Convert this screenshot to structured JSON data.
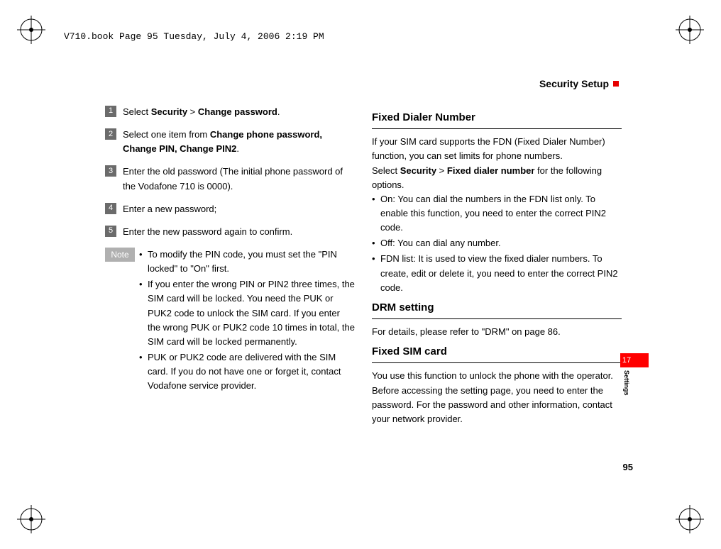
{
  "header": {
    "file_info": "V710.book  Page 95  Tuesday, July 4, 2006  2:19 PM"
  },
  "page_title": "Security Setup",
  "left_column": {
    "steps": [
      {
        "num": "1",
        "prefix": "Select ",
        "bold1": "Security",
        "mid": " > ",
        "bold2": "Change password",
        "suffix": "."
      },
      {
        "num": "2",
        "prefix": "Select one item from ",
        "bold1": "Change phone password, Change PIN, Change PIN2",
        "mid": "",
        "bold2": "",
        "suffix": "."
      },
      {
        "num": "3",
        "prefix": "Enter the old password (The initial phone password of the Vodafone 710 is 0000).",
        "bold1": "",
        "mid": "",
        "bold2": "",
        "suffix": ""
      },
      {
        "num": "4",
        "prefix": "Enter a new password;",
        "bold1": "",
        "mid": "",
        "bold2": "",
        "suffix": ""
      },
      {
        "num": "5",
        "prefix": "Enter the new password again to confirm.",
        "bold1": "",
        "mid": "",
        "bold2": "",
        "suffix": ""
      }
    ],
    "note_label": "Note",
    "note_items": [
      "To modify the PIN code, you must set the \"PIN locked\" to \"On\" first.",
      "If you enter the wrong PIN or PIN2 three times, the SIM card will be locked. You need the PUK or PUK2 code to unlock the SIM card. If you enter the wrong PUK or PUK2 code 10 times in total, the SIM card will be locked permanently.",
      "PUK or PUK2 code are delivered with the SIM card. If you do not have one or forget it, contact Vodafone service provider."
    ]
  },
  "right_column": {
    "section1": {
      "heading": "Fixed Dialer Number",
      "para1": "If your SIM card supports the FDN (Fixed Dialer Number) function, you can set limits for phone numbers.",
      "para2_pre": "Select ",
      "para2_b1": "Security",
      "para2_mid": " > ",
      "para2_b2": "Fixed dialer number",
      "para2_post": " for the following options.",
      "bullets": [
        "On: You can dial the numbers in the FDN list only. To enable this function, you need to enter the correct PIN2 code.",
        "Off: You can dial any number.",
        "FDN list: It is used to view the fixed dialer numbers. To create, edit or delete it, you need to enter the correct PIN2 code."
      ]
    },
    "section2": {
      "heading": "DRM setting",
      "para": "For details, please refer to \"DRM\" on page 86."
    },
    "section3": {
      "heading": "Fixed SIM card",
      "para": "You use this function to unlock the phone with the operator. Before accessing the setting page, you need to enter the password. For the password and other information, contact your network provider."
    }
  },
  "side_tab": {
    "number": "17",
    "label": "Settings"
  },
  "page_number": "95"
}
